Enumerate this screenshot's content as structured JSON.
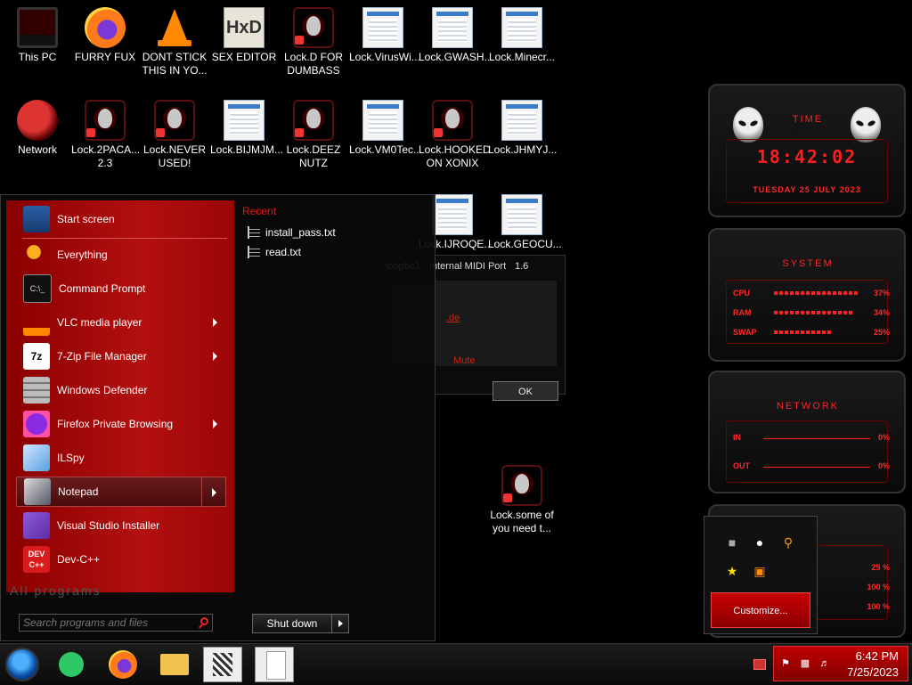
{
  "desktop": {
    "icons": [
      {
        "label": "This PC",
        "type": "pc"
      },
      {
        "label": "FURRY FUX",
        "type": "ff"
      },
      {
        "label": "DONT STICK\nTHIS IN YO...",
        "type": "vlc"
      },
      {
        "label": "SEX EDITOR",
        "type": "hxd"
      },
      {
        "label": "Lock.D FOR\nDUMBASS",
        "type": "lock"
      },
      {
        "label": "Lock.VirusWi...",
        "type": "win"
      },
      {
        "label": "Lock.GWASH...",
        "type": "win"
      },
      {
        "label": "Lock.Minecr...",
        "type": "win"
      },
      {
        "label": "Network",
        "type": "net"
      },
      {
        "label": "Lock.2PACA...\n2.3",
        "type": "lock"
      },
      {
        "label": "Lock.NEVER\nUSED!",
        "type": "lock"
      },
      {
        "label": "Lock.BIJMJM...",
        "type": "win"
      },
      {
        "label": "Lock.DEEZ\nNUTZ",
        "type": "lock"
      },
      {
        "label": "Lock.VM0Tec...",
        "type": "win"
      },
      {
        "label": "Lock.HOOKED\nON XONIX",
        "type": "lock"
      },
      {
        "label": "Lock.JHMYJ...",
        "type": "win"
      },
      {
        "label": "Lock.IJROQE...",
        "type": "win"
      },
      {
        "label": "Lock.GEOCU...",
        "type": "win"
      },
      {
        "label": "Lock.some of\nyou need t...",
        "type": "lock"
      }
    ]
  },
  "dialog": {
    "title": "loopbe1 - Internal MIDI Port",
    "version": "1.6",
    "link": ".de",
    "mute": "Mute",
    "ok_label": "OK"
  },
  "start_menu": {
    "items": [
      {
        "label": "Start screen",
        "icon": "start-screen-icon",
        "submenu": false
      },
      {
        "label": "Everything",
        "icon": "magnifier-icon",
        "submenu": false
      },
      {
        "label": "Command Prompt",
        "icon": "cmd-icon",
        "submenu": false
      },
      {
        "label": "VLC media player",
        "icon": "vlc-icon",
        "submenu": true
      },
      {
        "label": "7-Zip File Manager",
        "icon": "7zip-icon",
        "submenu": true
      },
      {
        "label": "Windows Defender",
        "icon": "defender-wall-icon",
        "submenu": false
      },
      {
        "label": "Firefox Private Browsing",
        "icon": "firefox-private-icon",
        "submenu": true
      },
      {
        "label": "ILSpy",
        "icon": "ilspy-icon",
        "submenu": false
      },
      {
        "label": "Notepad",
        "icon": "notepad-icon",
        "submenu": true
      },
      {
        "label": "Visual Studio Installer",
        "icon": "vs-installer-icon",
        "submenu": false
      },
      {
        "label": "Dev-C++",
        "icon": "devcpp-icon",
        "submenu": false
      }
    ],
    "recent_heading": "Recent",
    "recent": [
      "install_pass.txt",
      "read.txt"
    ],
    "all_programs": "All programs",
    "search_placeholder": "Search programs and files",
    "shutdown_label": "Shut down"
  },
  "gadgets": {
    "clock": {
      "title": "TIME",
      "time": "18:42:02",
      "date": "TUESDAY 25 JULY 2023"
    },
    "system": {
      "title": "SYSTEM",
      "rows": [
        {
          "label": "CPU",
          "value": "37%",
          "fraction": 0.37
        },
        {
          "label": "RAM",
          "value": "34%",
          "fraction": 0.34
        },
        {
          "label": "SWAP",
          "value": "25%",
          "fraction": 0.25
        }
      ]
    },
    "network": {
      "title": "NETWORK",
      "rows": [
        {
          "label": "IN",
          "value": "0%"
        },
        {
          "label": "OUT",
          "value": "0%"
        }
      ]
    },
    "bottom": {
      "title": "",
      "values": [
        "25 %",
        "100 %",
        "100 %"
      ]
    }
  },
  "tray_flyout": {
    "icons": [
      "usb-icon",
      "drop-icon",
      "search-icon",
      "star-icon",
      "tool-icon"
    ],
    "customize_label": "Customize..."
  },
  "taskbar": {
    "time": "6:42 PM",
    "date": "7/25/2023"
  },
  "colors": {
    "accent": "#ff1e1e",
    "menu_red": "#b30f0f",
    "tray_red": "#c00000"
  }
}
